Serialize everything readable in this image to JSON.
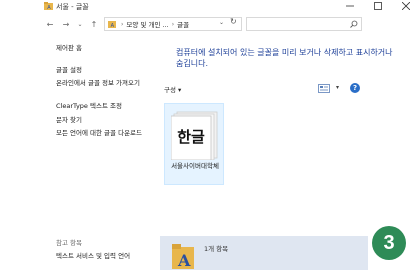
{
  "window": {
    "title": "서울 - 글꼴",
    "icon": "folder-icon"
  },
  "nav": {
    "address_parts": [
      "모양 및 개인 ...",
      "글꼴"
    ],
    "address_icon": "font-folder-icon"
  },
  "sidebar": {
    "home": "제어판 홈",
    "links": [
      "글꼴 설정",
      "온라인에서 글꼴 정보 가져오기",
      "ClearType 텍스트 조정",
      "문자 찾기",
      "모든 언어에 대한 글꼴 다운로드"
    ],
    "see_also_heading": "참고 항목",
    "see_also_link": "텍스트 서비스 및 입력 언어"
  },
  "main": {
    "heading": "컴퓨터에 설치되어 있는 글꼴을 미리 보거나 삭제하고 표시하거나 숨깁니다.",
    "organize_label": "구성 ▾",
    "help_label": "?",
    "file": {
      "preview": "한글",
      "label": "서울사이버대학체"
    }
  },
  "details": {
    "count": "1개 항목"
  },
  "badge": {
    "number": "3"
  },
  "colors": {
    "heading": "#1d3f98",
    "selection": "#e5f3ff",
    "details_bg": "#dfe6f1",
    "badge": "#2e8b57"
  }
}
